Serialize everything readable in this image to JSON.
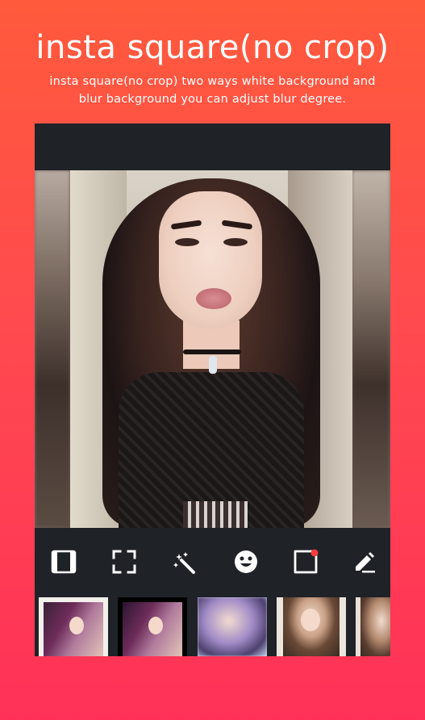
{
  "hero": {
    "title": "insta square(no crop)",
    "subtitle": "insta square(no crop) two ways white background and blur background you can adjust blur degree."
  },
  "toolbar": {
    "tools": [
      {
        "icon": "frame-border-icon"
      },
      {
        "icon": "fullscreen-icon"
      },
      {
        "icon": "magic-wand-icon"
      },
      {
        "icon": "emoji-icon"
      },
      {
        "icon": "sticker-icon",
        "has_badge": true
      },
      {
        "icon": "pencil-icon"
      }
    ]
  },
  "thumbnails": {
    "count_visible": 5,
    "selected_index": 0
  },
  "colors": {
    "gradient_top": "#ff5a3c",
    "gradient_bottom": "#ff3158",
    "panel": "#1f2227",
    "badge": "#ff3b3b",
    "icon": "#ffffff"
  }
}
